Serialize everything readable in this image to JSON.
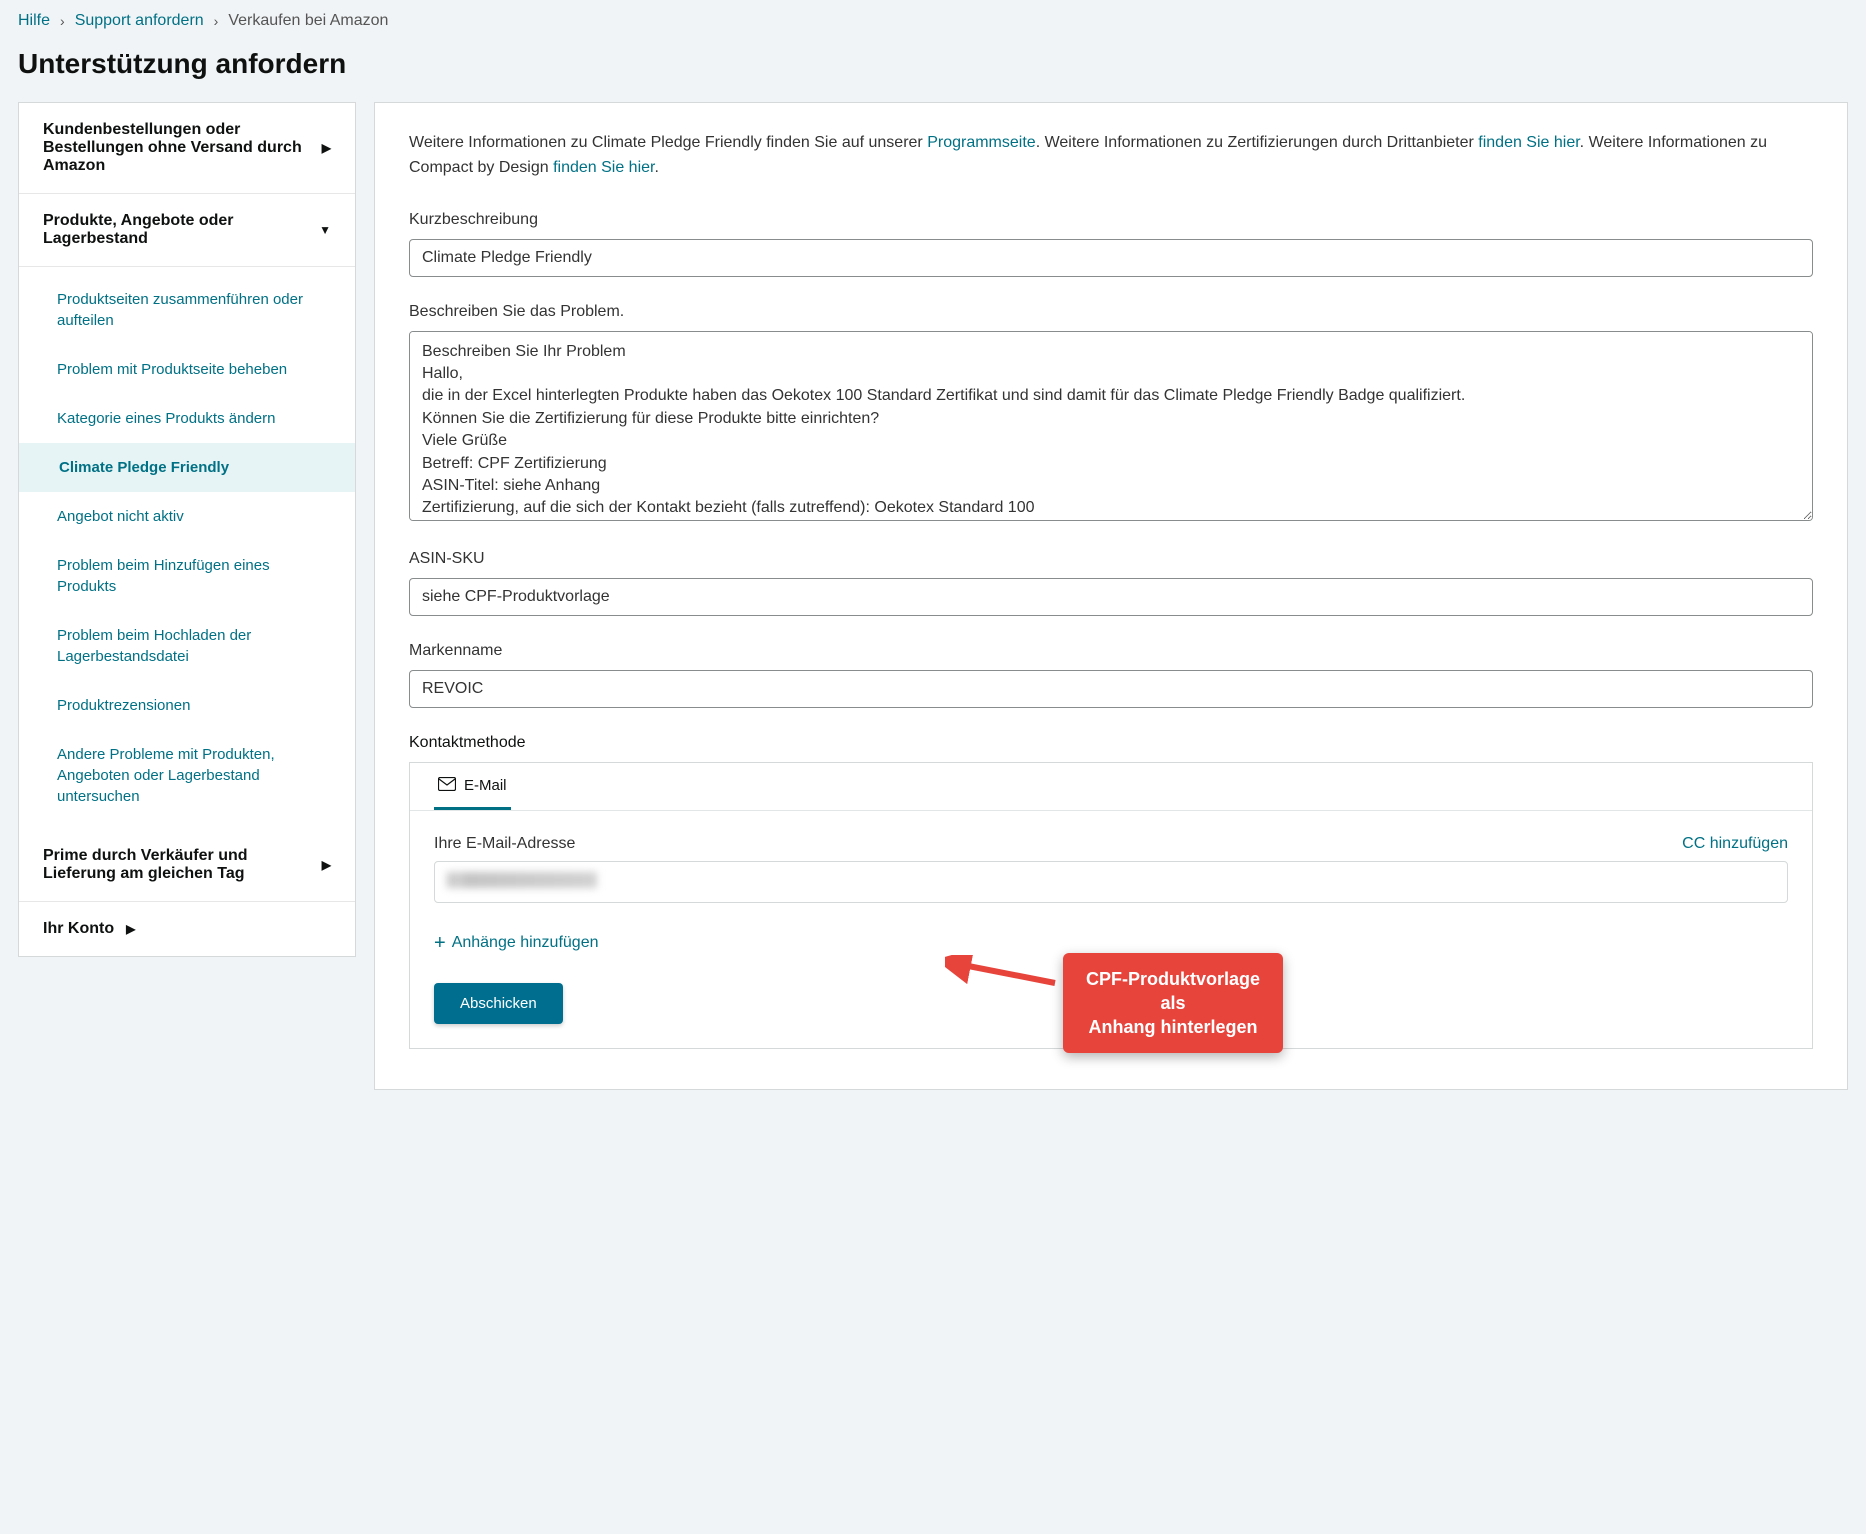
{
  "breadcrumb": {
    "items": [
      "Hilfe",
      "Support anfordern",
      "Verkaufen bei Amazon"
    ]
  },
  "page": {
    "title": "Unterstützung anfordern"
  },
  "sidebar": {
    "sections": [
      {
        "label": "Kundenbestellungen oder Bestellungen ohne Versand durch Amazon",
        "expanded": false
      },
      {
        "label": "Produkte, Angebote oder Lagerbestand",
        "expanded": true,
        "items": [
          {
            "label": "Produktseiten zusammenführen oder aufteilen"
          },
          {
            "label": "Problem mit Produktseite beheben"
          },
          {
            "label": "Kategorie eines Produkts ändern"
          },
          {
            "label": "Climate Pledge Friendly",
            "active": true
          },
          {
            "label": "Angebot nicht aktiv"
          },
          {
            "label": "Problem beim Hinzufügen eines Produkts"
          },
          {
            "label": "Problem beim Hochladen der Lagerbestandsdatei"
          },
          {
            "label": "Produktrezensionen"
          },
          {
            "label": "Andere Probleme mit Produkten, Angeboten oder Lagerbestand untersuchen"
          }
        ]
      },
      {
        "label": "Prime durch Verkäufer und Lieferung am gleichen Tag",
        "expanded": false
      },
      {
        "label": "Ihr Konto",
        "expanded": false
      }
    ]
  },
  "main": {
    "intro": {
      "t1": "Weitere Informationen zu Climate Pledge Friendly finden Sie auf unserer ",
      "link1": "Programmseite",
      "t2": ". Weitere Informationen zu Zertifizierungen durch Drittanbieter ",
      "link2": "finden Sie hier",
      "t3": ". Weitere Informationen zu Compact by Design ",
      "link3": "finden Sie hier",
      "t4": "."
    },
    "short_label": "Kurzbeschreibung",
    "short_value": "Climate Pledge Friendly",
    "desc_label": "Beschreiben Sie das Problem.",
    "desc_value": "Beschreiben Sie Ihr Problem\nHallo,\ndie in der Excel hinterlegten Produkte haben das Oekotex 100 Standard Zertifikat und sind damit für das Climate Pledge Friendly Badge qualifiziert.\nKönnen Sie die Zertifizierung für diese Produkte bitte einrichten?\nViele Grüße\nBetreff: CPF Zertifizierung\nASIN-Titel: siehe Anhang\nZertifizierung, auf die sich der Kontakt bezieht (falls zutreffend): Oekotex Standard 100",
    "asin_label": "ASIN-SKU",
    "asin_value": "siehe CPF-Produktvorlage",
    "brand_label": "Markenname",
    "brand_value": "REVOIC",
    "contact_label": "Kontaktmethode",
    "email_tab": "E-Mail",
    "email_label": "Ihre E-Mail-Adresse",
    "cc_label": "CC hinzufügen",
    "attach_label": "Anhänge hinzufügen",
    "submit_label": "Abschicken"
  },
  "callout": {
    "line1": "CPF-Produktvorlage als",
    "line2": "Anhang hinterlegen"
  }
}
